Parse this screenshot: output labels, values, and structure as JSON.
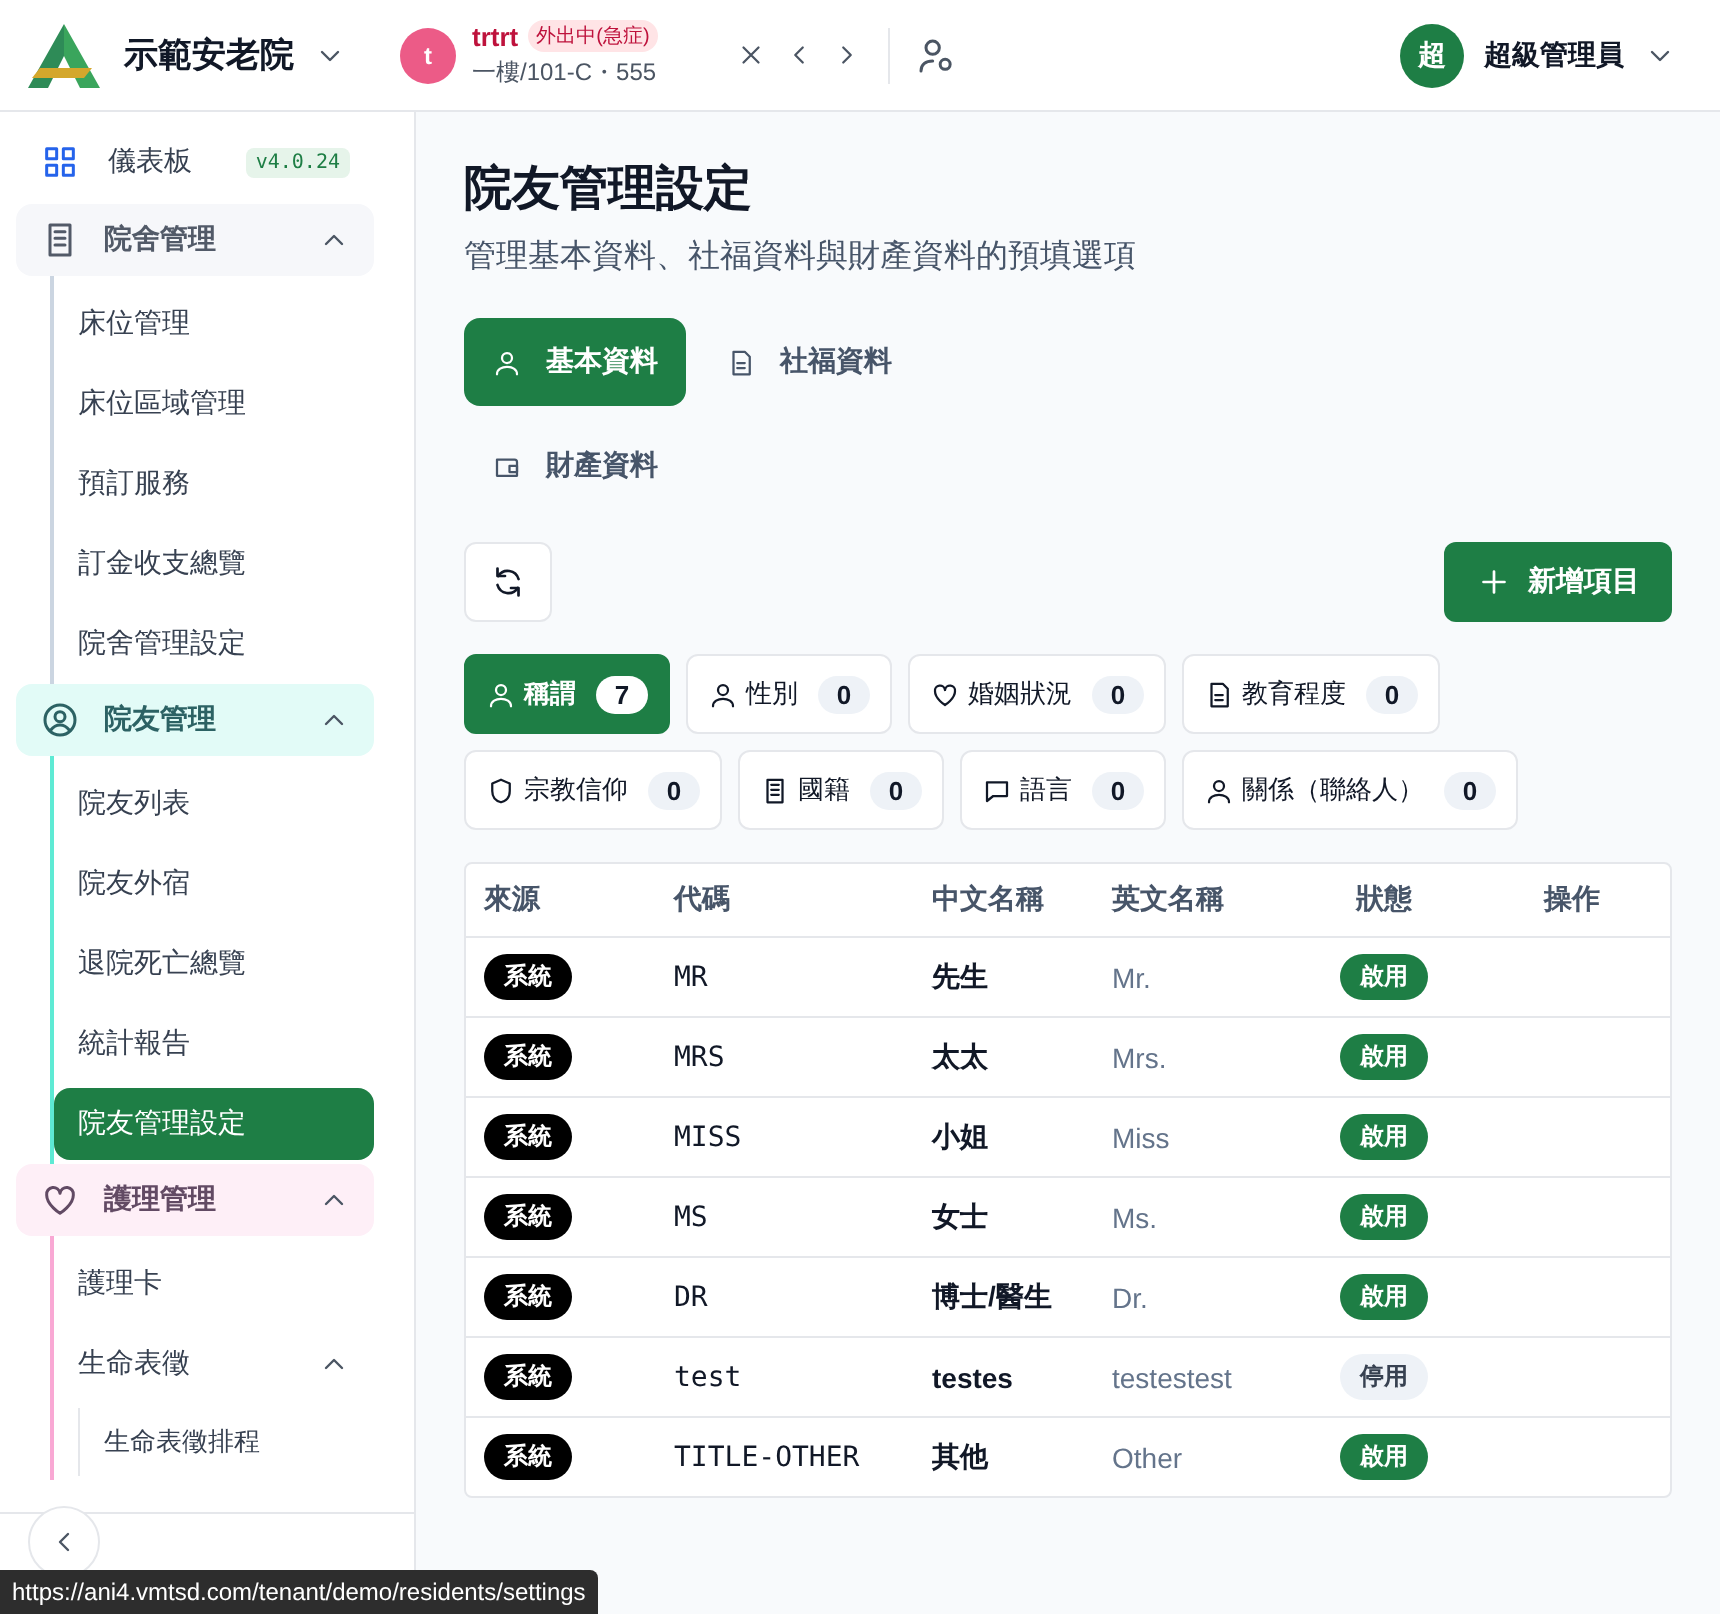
{
  "header": {
    "org_name": "示範安老院",
    "resident": {
      "avatar": "t",
      "name": "trtrt",
      "status": "外出中(急症)",
      "location": "一樓/101-C・555"
    },
    "user": {
      "avatar": "超",
      "name": "超級管理員"
    }
  },
  "sidebar": {
    "dashboard": {
      "label": "儀表板",
      "version": "v4.0.24"
    },
    "groups": [
      {
        "label": "院舍管理",
        "kind": "building",
        "color": "#cbd5e1",
        "expanded": true,
        "items": [
          {
            "label": "床位管理",
            "selected": false
          },
          {
            "label": "床位區域管理",
            "selected": false
          },
          {
            "label": "預訂服務",
            "selected": false
          },
          {
            "label": "訂金收支總覽",
            "selected": false
          },
          {
            "label": "院舍管理設定",
            "selected": false
          }
        ]
      },
      {
        "label": "院友管理",
        "kind": "resident",
        "color": "#5eead4",
        "expanded": true,
        "items": [
          {
            "label": "院友列表",
            "selected": false
          },
          {
            "label": "院友外宿",
            "selected": false
          },
          {
            "label": "退院死亡總覽",
            "selected": false
          },
          {
            "label": "統計報告",
            "selected": false
          },
          {
            "label": "院友管理設定",
            "selected": true
          }
        ]
      },
      {
        "label": "護理管理",
        "kind": "care",
        "color": "#f9a8d4",
        "expanded": true,
        "items": [
          {
            "label": "護理卡",
            "selected": false
          },
          {
            "label": "生命表徵",
            "selected": false,
            "expanded": true,
            "children": [
              {
                "label": "生命表徵排程",
                "selected": false
              }
            ]
          }
        ]
      }
    ]
  },
  "page": {
    "title": "院友管理設定",
    "subtitle": "管理基本資料、社福資料與財產資料的預填選項"
  },
  "tabs": [
    {
      "label": "基本資料",
      "kind": "basic",
      "selected": true
    },
    {
      "label": "社福資料",
      "kind": "welfare",
      "selected": false
    },
    {
      "label": "財產資料",
      "kind": "property",
      "selected": false
    }
  ],
  "add_button": "新增項目",
  "categories": [
    {
      "label": "稱謂",
      "kind": "person",
      "count": "7",
      "selected": true
    },
    {
      "label": "性別",
      "kind": "person",
      "count": "0",
      "selected": false
    },
    {
      "label": "婚姻狀況",
      "kind": "marital",
      "count": "0",
      "selected": false
    },
    {
      "label": "教育程度",
      "kind": "education",
      "count": "0",
      "selected": false
    },
    {
      "label": "宗教信仰",
      "kind": "religion",
      "count": "0",
      "selected": false
    },
    {
      "label": "國籍",
      "kind": "nationality",
      "count": "0",
      "selected": false
    },
    {
      "label": "語言",
      "kind": "language",
      "count": "0",
      "selected": false
    },
    {
      "label": "關係（聯絡人）",
      "kind": "person",
      "count": "0",
      "selected": false
    }
  ],
  "table": {
    "columns": [
      "來源",
      "代碼",
      "中文名稱",
      "英文名稱",
      "狀態",
      "操作"
    ],
    "rows": [
      {
        "source": "系統",
        "code": "MR",
        "name_zh": "先生",
        "name_en": "Mr.",
        "status": "啟用",
        "active": true
      },
      {
        "source": "系統",
        "code": "MRS",
        "name_zh": "太太",
        "name_en": "Mrs.",
        "status": "啟用",
        "active": true
      },
      {
        "source": "系統",
        "code": "MISS",
        "name_zh": "小姐",
        "name_en": "Miss",
        "status": "啟用",
        "active": true
      },
      {
        "source": "系統",
        "code": "MS",
        "name_zh": "女士",
        "name_en": "Ms.",
        "status": "啟用",
        "active": true
      },
      {
        "source": "系統",
        "code": "DR",
        "name_zh": "博士/醫生",
        "name_en": "Dr.",
        "status": "啟用",
        "active": true
      },
      {
        "source": "系統",
        "code": "test",
        "name_zh": "testes",
        "name_en": "testestest",
        "status": "停用",
        "active": false
      },
      {
        "source": "系統",
        "code": "TITLE-OTHER",
        "name_zh": "其他",
        "name_en": "Other",
        "status": "啟用",
        "active": true
      }
    ]
  },
  "status_url": "https://ani4.vmtsd.com/tenant/demo/residents/settings"
}
